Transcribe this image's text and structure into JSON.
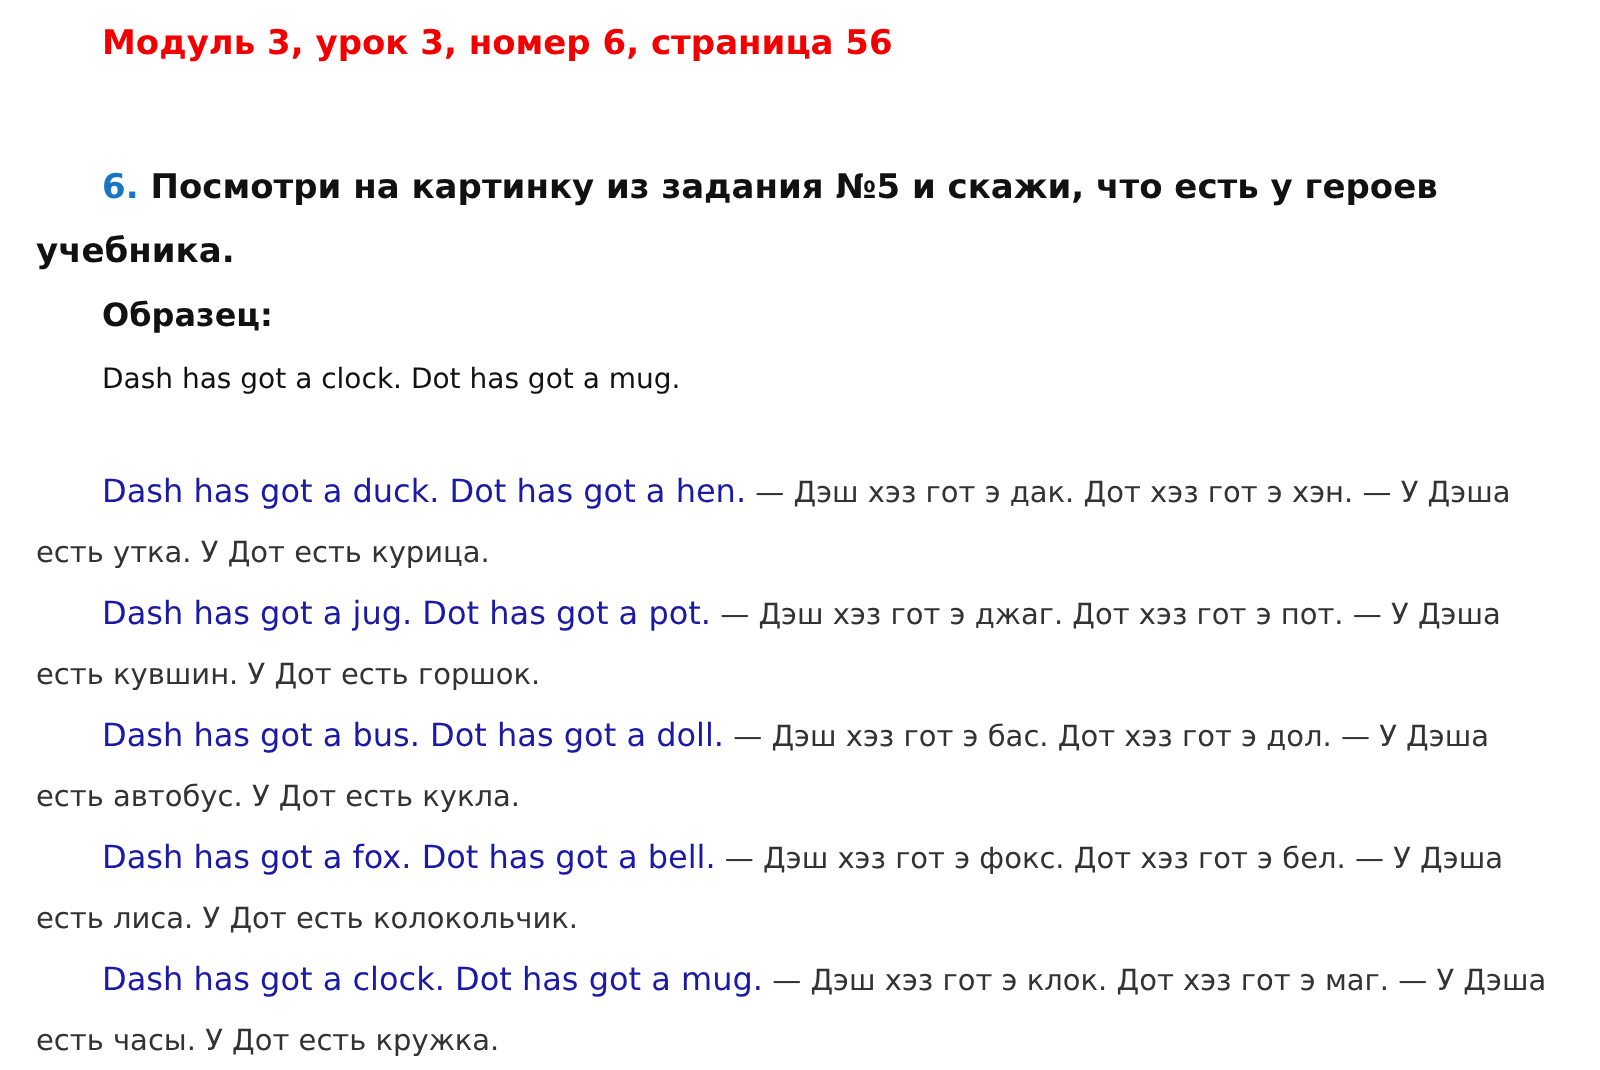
{
  "title": "Модуль 3, урок 3, номер 6, страница 56",
  "task": {
    "number": "6.",
    "text": "Посмотри на картинку из задания №5 и скажи, что есть у героев учебника."
  },
  "sample": {
    "label": "Образец:",
    "text": "Dash has got a clock. Dot has got a mug."
  },
  "answers": [
    {
      "english": "Dash has got a duck. Dot has got a hen.",
      "translation": "— Дэш хэз гот э дак. Дот хэз гот э хэн. — У Дэша есть утка. У Дот есть курица."
    },
    {
      "english": "Dash has got a jug. Dot has got a pot.",
      "translation": "— Дэш хэз гот э джаг. Дот хэз гот э пот. — У Дэша есть кувшин. У Дот есть горшок."
    },
    {
      "english": "Dash has got a bus. Dot has got a doll.",
      "translation": "— Дэш хэз гот э бас. Дот хэз гот э дол. — У Дэша есть автобус. У Дот есть кукла."
    },
    {
      "english": "Dash has got a fox. Dot has got a bell.",
      "translation": "— Дэш хэз гот э фокс. Дот хэз гот э бел. — У Дэша есть лиса. У Дот есть колокольчик."
    },
    {
      "english": "Dash has got a clock. Dot has got a mug.",
      "translation": "— Дэш хэз гот э клок. Дот хэз гот э маг. — У Дэша есть часы. У Дот есть кружка."
    }
  ]
}
